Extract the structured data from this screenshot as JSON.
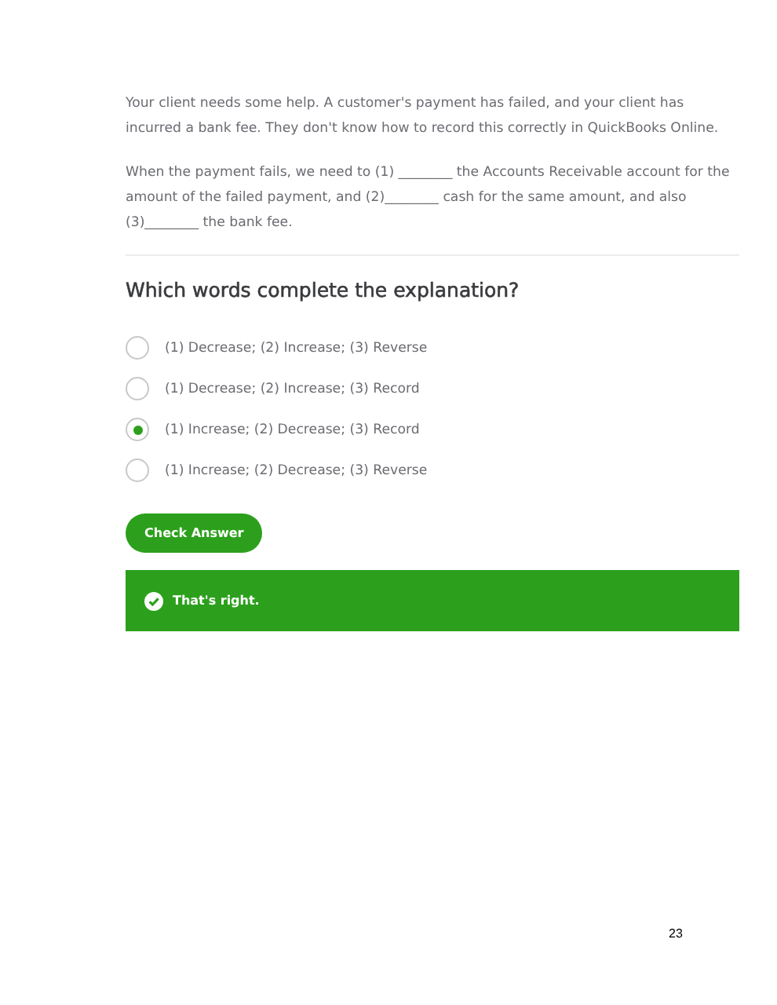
{
  "paragraphs": [
    "Your client needs some help. A customer's payment has failed, and your client has incurred a bank fee. They don't know how to record this correctly in QuickBooks Online.",
    "When the payment fails, we need to (1) ________ the Accounts Receivable account for the amount of the failed payment, and (2)________ cash for the same amount, and also (3)________ the bank fee."
  ],
  "question": "Which words complete the explanation?",
  "options": [
    {
      "label": "(1) Decrease; (2) Increase; (3) Reverse",
      "selected": false
    },
    {
      "label": "(1) Decrease; (2) Increase; (3) Record",
      "selected": false
    },
    {
      "label": "(1) Increase; (2) Decrease; (3) Record",
      "selected": true
    },
    {
      "label": "(1) Increase; (2) Decrease; (3) Reverse",
      "selected": false
    }
  ],
  "button": "Check Answer",
  "feedback": {
    "kind": "correct",
    "text": "That's right."
  },
  "page_number": "23"
}
